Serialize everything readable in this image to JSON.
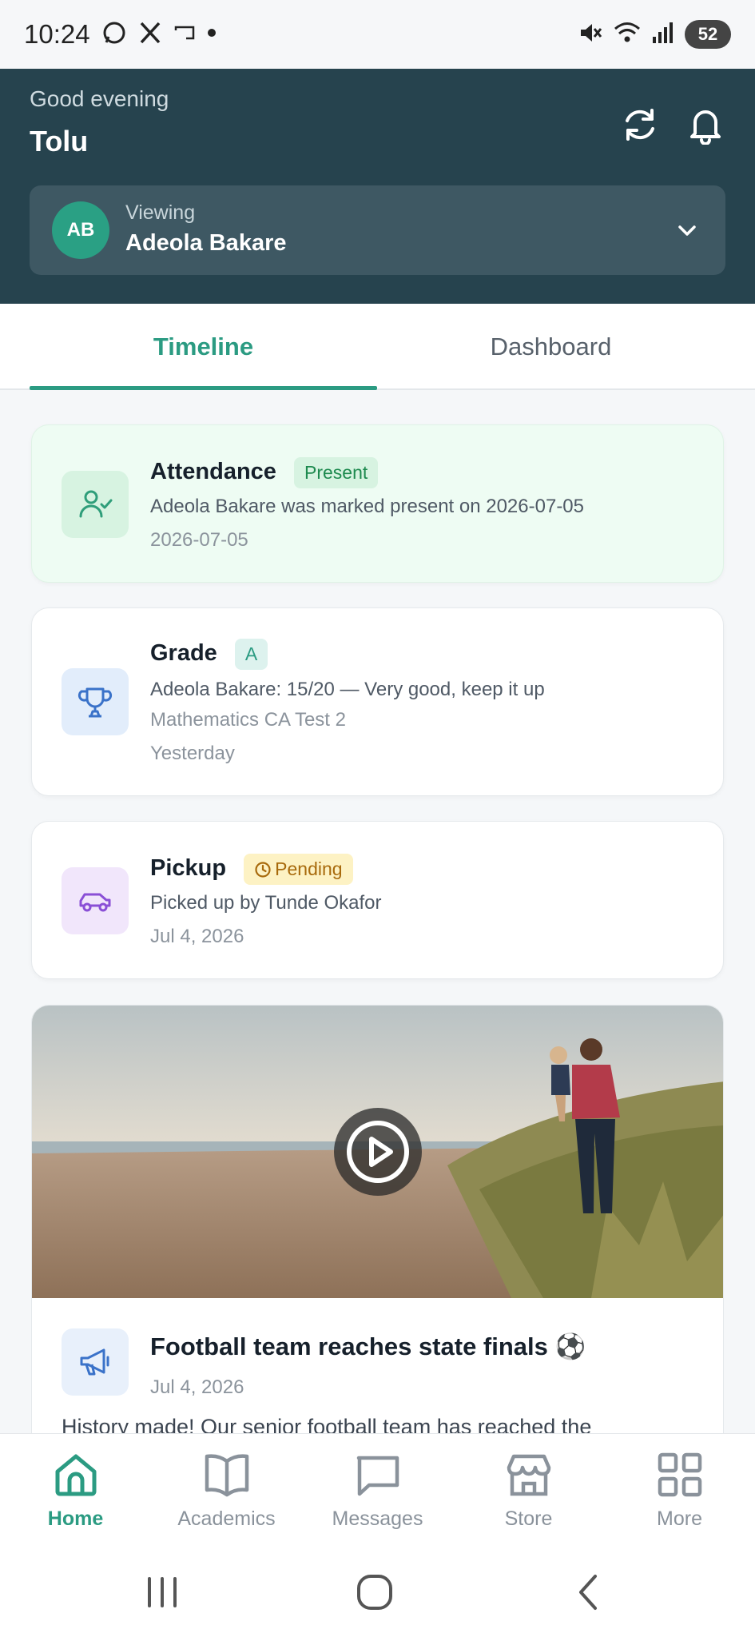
{
  "status_bar": {
    "time": "10:24",
    "battery": "52",
    "icons": [
      "whatsapp-icon",
      "x-icon",
      "cast-icon",
      "dot-icon",
      "mute-icon",
      "wifi-icon",
      "signal-icon"
    ]
  },
  "header": {
    "greeting": "Good evening",
    "user_name": "Tolu",
    "viewing_label": "Viewing",
    "child_initials": "AB",
    "child_name": "Adeola Bakare"
  },
  "tabs": [
    {
      "label": "Timeline",
      "active": true
    },
    {
      "label": "Dashboard",
      "active": false
    }
  ],
  "timeline": [
    {
      "type": "Attendance",
      "badge": "Present",
      "description": "Adeola Bakare was marked present on 2026-07-05",
      "date": "2026-07-05"
    },
    {
      "type": "Grade",
      "badge": "A",
      "description": "Adeola Bakare: 15/20 — Very good, keep it up",
      "subject": "Mathematics CA Test 2",
      "date": "Yesterday"
    },
    {
      "type": "Pickup",
      "badge": "Pending",
      "description": "Picked up by Tunde Okafor",
      "date": "Jul 4, 2026"
    }
  ],
  "news": {
    "title": "Football team reaches state finals ⚽",
    "date": "Jul 4, 2026",
    "excerpt": "History made! Our senior football team has reached the"
  },
  "bottom_nav": [
    {
      "label": "Home",
      "icon": "home-icon",
      "active": true
    },
    {
      "label": "Academics",
      "icon": "book-icon",
      "active": false
    },
    {
      "label": "Messages",
      "icon": "message-icon",
      "active": false
    },
    {
      "label": "Store",
      "icon": "store-icon",
      "active": false
    },
    {
      "label": "More",
      "icon": "grid-icon",
      "active": false
    }
  ],
  "colors": {
    "header_bg": "#26434e",
    "accent": "#2b9b82",
    "attendance_bg": "#eefcf3",
    "badge_present": "#d7f3e1",
    "badge_pending": "#fdf2c4"
  }
}
